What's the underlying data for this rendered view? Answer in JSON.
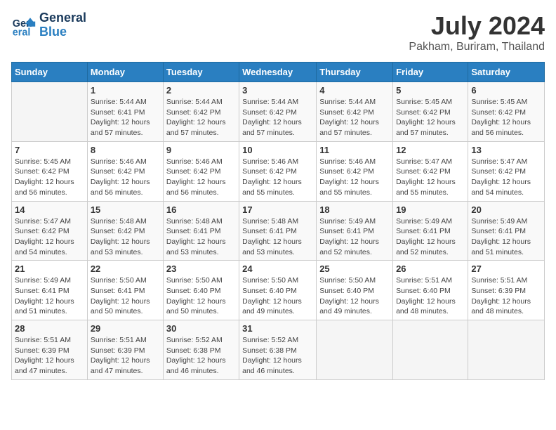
{
  "header": {
    "logo_line1": "General",
    "logo_line2": "Blue",
    "month_year": "July 2024",
    "location": "Pakham, Buriram, Thailand"
  },
  "days_of_week": [
    "Sunday",
    "Monday",
    "Tuesday",
    "Wednesday",
    "Thursday",
    "Friday",
    "Saturday"
  ],
  "weeks": [
    [
      {
        "day": "",
        "info": ""
      },
      {
        "day": "1",
        "info": "Sunrise: 5:44 AM\nSunset: 6:41 PM\nDaylight: 12 hours\nand 57 minutes."
      },
      {
        "day": "2",
        "info": "Sunrise: 5:44 AM\nSunset: 6:42 PM\nDaylight: 12 hours\nand 57 minutes."
      },
      {
        "day": "3",
        "info": "Sunrise: 5:44 AM\nSunset: 6:42 PM\nDaylight: 12 hours\nand 57 minutes."
      },
      {
        "day": "4",
        "info": "Sunrise: 5:44 AM\nSunset: 6:42 PM\nDaylight: 12 hours\nand 57 minutes."
      },
      {
        "day": "5",
        "info": "Sunrise: 5:45 AM\nSunset: 6:42 PM\nDaylight: 12 hours\nand 57 minutes."
      },
      {
        "day": "6",
        "info": "Sunrise: 5:45 AM\nSunset: 6:42 PM\nDaylight: 12 hours\nand 56 minutes."
      }
    ],
    [
      {
        "day": "7",
        "info": "Sunrise: 5:45 AM\nSunset: 6:42 PM\nDaylight: 12 hours\nand 56 minutes."
      },
      {
        "day": "8",
        "info": "Sunrise: 5:46 AM\nSunset: 6:42 PM\nDaylight: 12 hours\nand 56 minutes."
      },
      {
        "day": "9",
        "info": "Sunrise: 5:46 AM\nSunset: 6:42 PM\nDaylight: 12 hours\nand 56 minutes."
      },
      {
        "day": "10",
        "info": "Sunrise: 5:46 AM\nSunset: 6:42 PM\nDaylight: 12 hours\nand 55 minutes."
      },
      {
        "day": "11",
        "info": "Sunrise: 5:46 AM\nSunset: 6:42 PM\nDaylight: 12 hours\nand 55 minutes."
      },
      {
        "day": "12",
        "info": "Sunrise: 5:47 AM\nSunset: 6:42 PM\nDaylight: 12 hours\nand 55 minutes."
      },
      {
        "day": "13",
        "info": "Sunrise: 5:47 AM\nSunset: 6:42 PM\nDaylight: 12 hours\nand 54 minutes."
      }
    ],
    [
      {
        "day": "14",
        "info": "Sunrise: 5:47 AM\nSunset: 6:42 PM\nDaylight: 12 hours\nand 54 minutes."
      },
      {
        "day": "15",
        "info": "Sunrise: 5:48 AM\nSunset: 6:42 PM\nDaylight: 12 hours\nand 53 minutes."
      },
      {
        "day": "16",
        "info": "Sunrise: 5:48 AM\nSunset: 6:41 PM\nDaylight: 12 hours\nand 53 minutes."
      },
      {
        "day": "17",
        "info": "Sunrise: 5:48 AM\nSunset: 6:41 PM\nDaylight: 12 hours\nand 53 minutes."
      },
      {
        "day": "18",
        "info": "Sunrise: 5:49 AM\nSunset: 6:41 PM\nDaylight: 12 hours\nand 52 minutes."
      },
      {
        "day": "19",
        "info": "Sunrise: 5:49 AM\nSunset: 6:41 PM\nDaylight: 12 hours\nand 52 minutes."
      },
      {
        "day": "20",
        "info": "Sunrise: 5:49 AM\nSunset: 6:41 PM\nDaylight: 12 hours\nand 51 minutes."
      }
    ],
    [
      {
        "day": "21",
        "info": "Sunrise: 5:49 AM\nSunset: 6:41 PM\nDaylight: 12 hours\nand 51 minutes."
      },
      {
        "day": "22",
        "info": "Sunrise: 5:50 AM\nSunset: 6:41 PM\nDaylight: 12 hours\nand 50 minutes."
      },
      {
        "day": "23",
        "info": "Sunrise: 5:50 AM\nSunset: 6:40 PM\nDaylight: 12 hours\nand 50 minutes."
      },
      {
        "day": "24",
        "info": "Sunrise: 5:50 AM\nSunset: 6:40 PM\nDaylight: 12 hours\nand 49 minutes."
      },
      {
        "day": "25",
        "info": "Sunrise: 5:50 AM\nSunset: 6:40 PM\nDaylight: 12 hours\nand 49 minutes."
      },
      {
        "day": "26",
        "info": "Sunrise: 5:51 AM\nSunset: 6:40 PM\nDaylight: 12 hours\nand 48 minutes."
      },
      {
        "day": "27",
        "info": "Sunrise: 5:51 AM\nSunset: 6:39 PM\nDaylight: 12 hours\nand 48 minutes."
      }
    ],
    [
      {
        "day": "28",
        "info": "Sunrise: 5:51 AM\nSunset: 6:39 PM\nDaylight: 12 hours\nand 47 minutes."
      },
      {
        "day": "29",
        "info": "Sunrise: 5:51 AM\nSunset: 6:39 PM\nDaylight: 12 hours\nand 47 minutes."
      },
      {
        "day": "30",
        "info": "Sunrise: 5:52 AM\nSunset: 6:38 PM\nDaylight: 12 hours\nand 46 minutes."
      },
      {
        "day": "31",
        "info": "Sunrise: 5:52 AM\nSunset: 6:38 PM\nDaylight: 12 hours\nand 46 minutes."
      },
      {
        "day": "",
        "info": ""
      },
      {
        "day": "",
        "info": ""
      },
      {
        "day": "",
        "info": ""
      }
    ]
  ]
}
